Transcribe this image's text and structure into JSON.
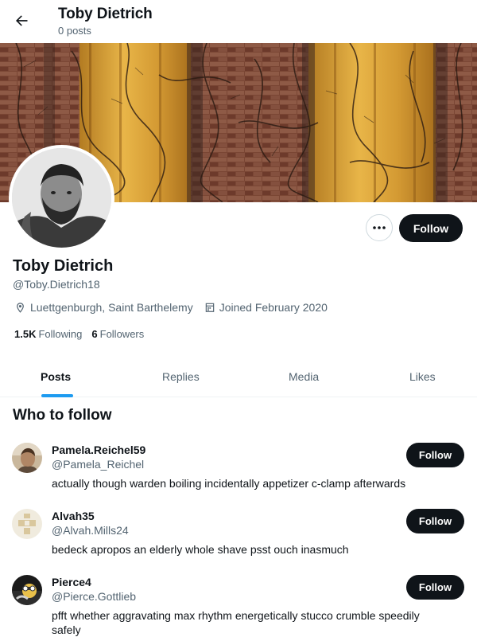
{
  "header": {
    "title": "Toby Dietrich",
    "subtitle": "0 posts"
  },
  "profile": {
    "name": "Toby Dietrich",
    "handle": "@Toby.Dietrich18",
    "location": "Luettgenburgh, Saint Barthelemy",
    "joined": "Joined February 2020",
    "following_count": "1.5K",
    "following_label": "Following",
    "followers_count": "6",
    "followers_label": "Followers",
    "follow_label": "Follow"
  },
  "tabs": [
    {
      "label": "Posts",
      "active": true
    },
    {
      "label": "Replies",
      "active": false
    },
    {
      "label": "Media",
      "active": false
    },
    {
      "label": "Likes",
      "active": false
    }
  ],
  "who_to_follow": {
    "title": "Who to follow",
    "users": [
      {
        "name": "Pamela.Reichel59",
        "handle": "@Pamela_Reichel",
        "bio": "actually though warden boiling incidentally appetizer c-clamp afterwards",
        "follow_label": "Follow"
      },
      {
        "name": "Alvah35",
        "handle": "@Alvah.Mills24",
        "bio": "bedeck apropos an elderly whole shave psst ouch inasmuch",
        "follow_label": "Follow"
      },
      {
        "name": "Pierce4",
        "handle": "@Pierce.Gottlieb",
        "bio": "pfft whether aggravating max rhythm energetically stucco crumble speedily safely",
        "follow_label": "Follow"
      }
    ]
  },
  "colors": {
    "accent": "#1d9bf0",
    "button": "#0f1419",
    "muted": "#536471"
  }
}
